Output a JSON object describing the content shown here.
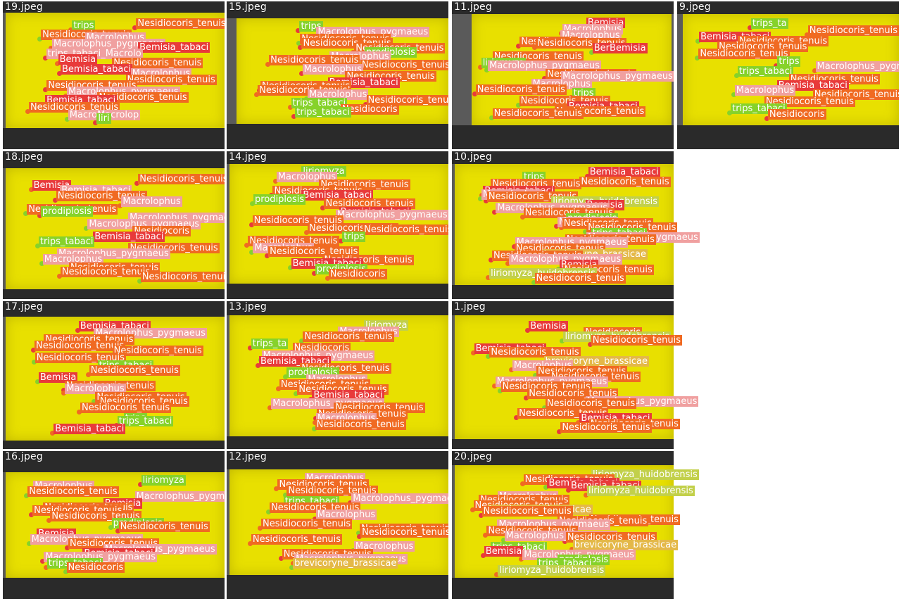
{
  "colors": {
    "background": "#ffffff",
    "tile_border": "#5a5a5a",
    "trap_yellow": "#e8e000",
    "nesidiocoris": "#f06a22",
    "macrolophus": "#f0a0a0",
    "bemisia": "#e83a3a",
    "trips": "#86d22a",
    "liriomyza": "#c2d04a",
    "prodiplosis": "#a4d840",
    "brevicoryne": "#e4b848"
  },
  "tiles": [
    {
      "label": "19.jpeg",
      "dets": [
        [
          "nes",
          "Nesidiocoris_tenuisNesidiocoris_tenuis"
        ],
        [
          "tri",
          "trips"
        ],
        [
          "nes",
          "Nesidiocoris_tenuis"
        ],
        [
          "mac",
          "Macrolophus"
        ],
        [
          "mac",
          "Macrolophus_pygmaeus"
        ],
        [
          "bem",
          "Bemisia_tabaci"
        ],
        [
          "mac",
          "trips_tabaci_Macrolo"
        ],
        [
          "bem",
          "Bemisia"
        ],
        [
          "nes",
          "Nesidiocoris_tenuis"
        ],
        [
          "bem",
          "Bemisia_tabaci"
        ],
        [
          "mac",
          "Macrolophus"
        ],
        [
          "nes",
          "Nesidiocoris_tenuis"
        ],
        [
          "nes",
          "Nesidiocoris_tenuis"
        ],
        [
          "mac",
          "Macrolophus_pygmaeus"
        ],
        [
          "nes",
          "Nesidiocoris_tenuis"
        ],
        [
          "bem",
          "Bemisia_tabaci"
        ],
        [
          "nes",
          "Nesidiocoris_tenuis"
        ],
        [
          "mac",
          "MacroMacrolop"
        ],
        [
          "tri",
          "liri"
        ]
      ]
    },
    {
      "label": "15.jpeg",
      "dets": [
        [
          "tri",
          "trips"
        ],
        [
          "mac",
          "Macrolophus_pygmaeus"
        ],
        [
          "nes",
          "Nesidiocoris_tenuis"
        ],
        [
          "nes",
          "Nesidiocoris_tenuis"
        ],
        [
          "nes",
          "Nesidiocoris_tenuis"
        ],
        [
          "tri",
          "prodiplosis"
        ],
        [
          "mac",
          "Macrolophus"
        ],
        [
          "nes",
          "Nesidiocoris_tenuis"
        ],
        [
          "nes",
          "Nesidiocoris_tenuis"
        ],
        [
          "mac",
          "Macrolophus"
        ],
        [
          "nes",
          "Nesidiocoris_tenuis"
        ],
        [
          "bem",
          "Bemisia_tabaci"
        ],
        [
          "nes",
          "Nesidiocoris_tenuis"
        ],
        [
          "nes",
          "Nesidiocoris_tenuis"
        ],
        [
          "mac",
          "Macrolophus"
        ],
        [
          "nes",
          "Nesidiocoris_tenuis"
        ],
        [
          "tri",
          "trips_tabaci"
        ],
        [
          "nes",
          "Nesidiocoris"
        ],
        [
          "tri",
          "trips_tabaci"
        ]
      ]
    },
    {
      "label": "11.jpeg",
      "dets": [
        [
          "bem",
          "Bemisia"
        ],
        [
          "mac",
          "Macrolophus"
        ],
        [
          "mac",
          "Macrolophus"
        ],
        [
          "nes",
          "Nesidiocoris"
        ],
        [
          "nes",
          "Nesidiocoris_tenuis"
        ],
        [
          "bem",
          "BerBemisia"
        ],
        [
          "nes",
          "Nesidiocoris_tenuis"
        ],
        [
          "tri",
          "liriomyza"
        ],
        [
          "mac",
          "Macrolophus_pygmaeus"
        ],
        [
          "nes",
          "Nesidiocoris_tenuis"
        ],
        [
          "mac",
          "Macrolophus_pygmaeus"
        ],
        [
          "mac",
          "Macrolophus"
        ],
        [
          "nes",
          "Nesidiocoris_tenuis"
        ],
        [
          "tri",
          "trips"
        ],
        [
          "nes",
          "Nesidiocoris_tenuis"
        ],
        [
          "bem",
          "Bemisia_tabaci"
        ],
        [
          "nes",
          "Nesidiocoris_tenuis"
        ],
        [
          "nes",
          "Nesidiocoris_tenuis"
        ]
      ]
    },
    {
      "label": "9.jpeg",
      "dets": [
        [
          "tri",
          "trips_ta"
        ],
        [
          "nes",
          "Nesidiocoris_tenuis"
        ],
        [
          "bem",
          "Bemisia_tabaci"
        ],
        [
          "nes",
          "Nesidiocoris_tenuis"
        ],
        [
          "nes",
          "Nesidiocoris_tenuis"
        ],
        [
          "nes",
          "Nesidiocoris_tenuis"
        ],
        [
          "tri",
          "trips"
        ],
        [
          "mac",
          "Macrolophus_pygmaeus"
        ],
        [
          "tri",
          "trips_tabaci"
        ],
        [
          "nes",
          "Nesidiocoris_tenuis"
        ],
        [
          "bem",
          "Bemisia_tabaci"
        ],
        [
          "mac",
          "Macrolophus"
        ],
        [
          "nes",
          "Nesidiocoris_tenuis"
        ],
        [
          "nes",
          "Nesidiocoris_tenuis"
        ],
        [
          "tri",
          "trips_tabaci"
        ],
        [
          "nes",
          "Nesidiocoris"
        ]
      ]
    },
    {
      "label": "18.jpeg",
      "dets": [
        [
          "nes",
          "Nesidiocoris_tenuis"
        ],
        [
          "bem",
          "Bemisia"
        ],
        [
          "mac",
          "Bemisia_tabaci"
        ],
        [
          "nes",
          "Nesidiocoris_tenuis"
        ],
        [
          "mac",
          "Macrolophus"
        ],
        [
          "nes",
          "Nesidiocoris_tenuis"
        ],
        [
          "tri",
          "prodiplosis"
        ],
        [
          "mac",
          "Macrolophus_pygmaeus"
        ],
        [
          "mac",
          "Macrolophus_pygmaeus"
        ],
        [
          "nes",
          "Nesidiocoris"
        ],
        [
          "bem",
          "Bemisia_tabaci"
        ],
        [
          "tri",
          "trips_tabaci"
        ],
        [
          "nes",
          "Nesidiocoris_tenuis"
        ],
        [
          "mac",
          "Macrolophus_pygmaeus"
        ],
        [
          "mac",
          "Macrolophus"
        ],
        [
          "nes",
          "Nesidiocoris_tenuis"
        ],
        [
          "nes",
          "Nesidiocoris_tenuis"
        ],
        [
          "nes",
          "Nesidiocoris_tenuis"
        ]
      ]
    },
    {
      "label": "14.jpeg",
      "dets": [
        [
          "tri",
          "liriomyza"
        ],
        [
          "mac",
          "Macrolophus"
        ],
        [
          "nes",
          "Nesidiocoris_tenuis"
        ],
        [
          "nes",
          "Nesidiocoris_tenuis"
        ],
        [
          "bem",
          "Bemisia_tabaci"
        ],
        [
          "tri",
          "prodiplosis"
        ],
        [
          "nes",
          "Nesidiocoris_tenuis"
        ],
        [
          "bem",
          "Bemisia_tabaci"
        ],
        [
          "mac",
          "Macrolophus_pygmaeus"
        ],
        [
          "nes",
          "Nesidiocoris_tenuis"
        ],
        [
          "nes",
          "Nesidiocoris_tenuis"
        ],
        [
          "nes",
          "Nesidiocoris_tenuis"
        ],
        [
          "tri",
          "trips"
        ],
        [
          "nes",
          "Nesidiocoris_tenuis"
        ],
        [
          "mac",
          "Macrolophus"
        ],
        [
          "nes",
          "Nesidiocoris_tenuis"
        ],
        [
          "nes",
          "Nesidiocoris_tenuis"
        ],
        [
          "bem",
          "Bemisia_tabaci"
        ],
        [
          "tri",
          "prodiplosis"
        ],
        [
          "nes",
          "Nesidiocoris"
        ]
      ]
    },
    {
      "label": "10.jpeg",
      "dets": [
        [
          "bem",
          "Bemisia_tabaci"
        ],
        [
          "tri",
          "trips"
        ],
        [
          "nes",
          "Nesidiocoris_tenuis"
        ],
        [
          "nes",
          "Nesidiocoris_tenuis"
        ],
        [
          "bem",
          "Bemisia_tabaci"
        ],
        [
          "mac",
          "Macrolophus"
        ],
        [
          "nes",
          "Nesidiocoris_tenuis"
        ],
        [
          "lir",
          "liriomyza_huidobrensis"
        ],
        [
          "bem",
          "Bemisia"
        ],
        [
          "mac",
          "Macrolophus_pygmaeus"
        ],
        [
          "nes",
          "Nesidiocoris_tenuis"
        ],
        [
          "tri",
          "prodiplosis"
        ],
        [
          "mac",
          "Macrolophus"
        ],
        [
          "nes",
          "Nesidiocoris_tenuis"
        ],
        [
          "nes",
          "Nesidiocoris_tenuis"
        ],
        [
          "tri",
          "trips_tabaci"
        ],
        [
          "mac",
          "Macrolophus_pygmaeus"
        ],
        [
          "nes",
          "Nesidiocoris_tenuis"
        ],
        [
          "mac",
          "Macrolophus_pygmaeus"
        ],
        [
          "nes",
          "Nesidiocoris_tenuis"
        ],
        [
          "bre",
          "brevicoryne_brassicae"
        ],
        [
          "nes",
          "Nesidiocoris_tenuis"
        ],
        [
          "mac",
          "Macrolophus_pygmaeus"
        ],
        [
          "bem",
          "Bemisia"
        ],
        [
          "nes",
          "Nesidiocoris_tenuis"
        ],
        [
          "lir",
          "liriomyza_huidobrensis"
        ],
        [
          "nes",
          "Nesidiocoris_tenuis"
        ]
      ]
    },
    {
      "label": "17.jpeg",
      "dets": [
        [
          "bem",
          "Bemisia_tabaci"
        ],
        [
          "mac",
          "Macrolophus_pygmaeus"
        ],
        [
          "nes",
          "Nesidiocoris_tenuis"
        ],
        [
          "nes",
          "Nesidiocoris_tenuis"
        ],
        [
          "nes",
          "Nesidiocoris_tenuis"
        ],
        [
          "nes",
          "Nesidiocoris_tenuis"
        ],
        [
          "tri",
          "trips_tabaci"
        ],
        [
          "nes",
          "Nesidiocoris_tenuis"
        ],
        [
          "bem",
          "Bemisia"
        ],
        [
          "nes",
          "Nesidiocoris_tenuis"
        ],
        [
          "mac",
          "Macrolophus"
        ],
        [
          "nes",
          "Nesidiocoris_tenuis"
        ],
        [
          "nes",
          "Nesidiocoris_tenuis"
        ],
        [
          "nes",
          "Nesidiocoris_tenuis"
        ],
        [
          "tri",
          "trips"
        ],
        [
          "tri",
          "trips_tabaci"
        ],
        [
          "bem",
          "Bemisia_tabaci"
        ]
      ]
    },
    {
      "label": "13.jpeg",
      "dets": [
        [
          "lir",
          "liriomyza"
        ],
        [
          "mac",
          "Macrolophus"
        ],
        [
          "nes",
          "Nesidiocoris_tenuis"
        ],
        [
          "tri",
          "trips_ta"
        ],
        [
          "nes",
          "Nesidiocoris"
        ],
        [
          "mac",
          "Macrolophus_pygmaeus"
        ],
        [
          "bem",
          "Bemisia_tabaci"
        ],
        [
          "nes",
          "Nesidiocoris_tenuis"
        ],
        [
          "tri",
          "prodiplosis"
        ],
        [
          "mac",
          "Macrolophus"
        ],
        [
          "nes",
          "Nesidiocoris_tenuis"
        ],
        [
          "nes",
          "Nesidiocoris_tenuis"
        ],
        [
          "bem",
          "Bemisia_tabaci"
        ],
        [
          "mac",
          "Macrolophus_pygmaeus"
        ],
        [
          "nes",
          "Nesidiocoris_tenuis"
        ],
        [
          "nes",
          "Nesidiocoris_tenuis"
        ],
        [
          "mac",
          "Macrolophus"
        ],
        [
          "nes",
          "Nesidiocoris_tenuis"
        ]
      ]
    },
    {
      "label": "1.jpeg",
      "dets": [
        [
          "bem",
          "Bemisia"
        ],
        [
          "nes",
          "Nesidiocoris"
        ],
        [
          "lir",
          "liriomyza_huidobrensis"
        ],
        [
          "nes",
          "Nesidiocoris_tenuis"
        ],
        [
          "bem",
          "Bemisia_tabaci"
        ],
        [
          "nes",
          "Nesidiocoris_tenuis"
        ],
        [
          "bre",
          "brevicoryne_brassicae"
        ],
        [
          "mac",
          "Macrolophus"
        ],
        [
          "nes",
          "Nesidiocoris_tenuis"
        ],
        [
          "nes",
          "Nesidiocoris_tenuis"
        ],
        [
          "mac",
          "Macrolophus_pygmaeus"
        ],
        [
          "nes",
          "Nesidiocoris_tenuis"
        ],
        [
          "nes",
          "Nesidiocoris_tenuis"
        ],
        [
          "mac",
          "Macrolophus_pygmaeus"
        ],
        [
          "nes",
          "Nesidiocoris_tenuis"
        ],
        [
          "nes",
          "Nesidiocoris_tenuis"
        ],
        [
          "bem",
          "Bemisia_tabaci"
        ],
        [
          "nes",
          "Nesidiocoris_tenuis"
        ],
        [
          "nes",
          "Nesidiocoris_tenuis"
        ]
      ]
    },
    {
      "label": "16.jpeg",
      "dets": [
        [
          "tri",
          "liriomyza"
        ],
        [
          "mac",
          "Macrolophus"
        ],
        [
          "nes",
          "Nesidiocoris_tenuis"
        ],
        [
          "mac",
          "Macrolophus_pygmaeus"
        ],
        [
          "bem",
          "Bemisia"
        ],
        [
          "nes",
          "Nesidiocoris_tenuis"
        ],
        [
          "nes",
          "Nesidiocoris_tenuis"
        ],
        [
          "nes",
          "Nesidiocoris_tenuis"
        ],
        [
          "tri",
          "prodiplosis"
        ],
        [
          "nes",
          "Nesidiocoris_tenuis"
        ],
        [
          "bem",
          "Bemisia"
        ],
        [
          "mac",
          "Macrolophus_pygmaeus"
        ],
        [
          "nes",
          "Nesidiocoris_tenuis"
        ],
        [
          "mac",
          "Macrolophus_pygmaeus"
        ],
        [
          "bem",
          "Bemisia_tabaci"
        ],
        [
          "mac",
          "Macrolophus_pygmaeus"
        ],
        [
          "tri",
          "trips_tabaci"
        ],
        [
          "nes",
          "Nesidiocoris"
        ]
      ]
    },
    {
      "label": "12.jpeg",
      "dets": [
        [
          "mac",
          "Macrolophus"
        ],
        [
          "nes",
          "Nesidiocoris_tenuis"
        ],
        [
          "nes",
          "Nesidiocoris_tenuis"
        ],
        [
          "mac",
          "Macrolophus_pygmaeus"
        ],
        [
          "tri",
          "trips_tabaci"
        ],
        [
          "nes",
          "Nesidiocoris_tenuis"
        ],
        [
          "mac",
          "Macrolophus"
        ],
        [
          "nes",
          "Nesidiocoris_tenuis"
        ],
        [
          "nes",
          "Nesidiocoris_tenuis"
        ],
        [
          "nes",
          "Nesidiocoris_tenuis"
        ],
        [
          "nes",
          "Nesidiocoris_tenuis"
        ],
        [
          "mac",
          "Macrolophus"
        ],
        [
          "nes",
          "Nesidiocoris_tenuis"
        ],
        [
          "mac",
          "Macrolophus_pygmaeus"
        ],
        [
          "bre",
          "brevicoryne_brassicae"
        ]
      ]
    },
    {
      "label": "20.jpeg",
      "dets": [
        [
          "lir",
          "liriomyza_huidobrensis"
        ],
        [
          "nes",
          "Nesidiocoris_tenuis"
        ],
        [
          "bem",
          "Bemisia_tabaci"
        ],
        [
          "bem",
          "Bemisia_tabaci"
        ],
        [
          "lir",
          "liriomyza_huidobrensis"
        ],
        [
          "mac",
          "Macrolophus"
        ],
        [
          "nes",
          "Nesidiocoris_tenuis"
        ],
        [
          "nes",
          "Nesidiocoris_tenuis"
        ],
        [
          "bre",
          "brevicoryne_brassicae"
        ],
        [
          "nes",
          "Nesidiocoris_tenuis"
        ],
        [
          "nes",
          "Nesidiocoris_tenuis"
        ],
        [
          "nes",
          "Nesidiocoris_tenuis"
        ],
        [
          "mac",
          "Macrolophus_pygmaeus"
        ],
        [
          "nes",
          "Nesidiocoris_tenuis"
        ],
        [
          "mac",
          "Macrolophus_pygmaeus"
        ],
        [
          "nes",
          "Nesidiocoris_tenuis"
        ],
        [
          "bre",
          "brevicoryne_brassicae"
        ],
        [
          "tri",
          "trips_tabaci"
        ],
        [
          "bem",
          "Bemisia"
        ],
        [
          "mac",
          "Macrolophus_pygmaeus"
        ],
        [
          "tri",
          "prodiplosis"
        ],
        [
          "tri",
          "trips_tabaci"
        ],
        [
          "lir",
          "liriomyza_huidobrensis"
        ]
      ]
    }
  ]
}
